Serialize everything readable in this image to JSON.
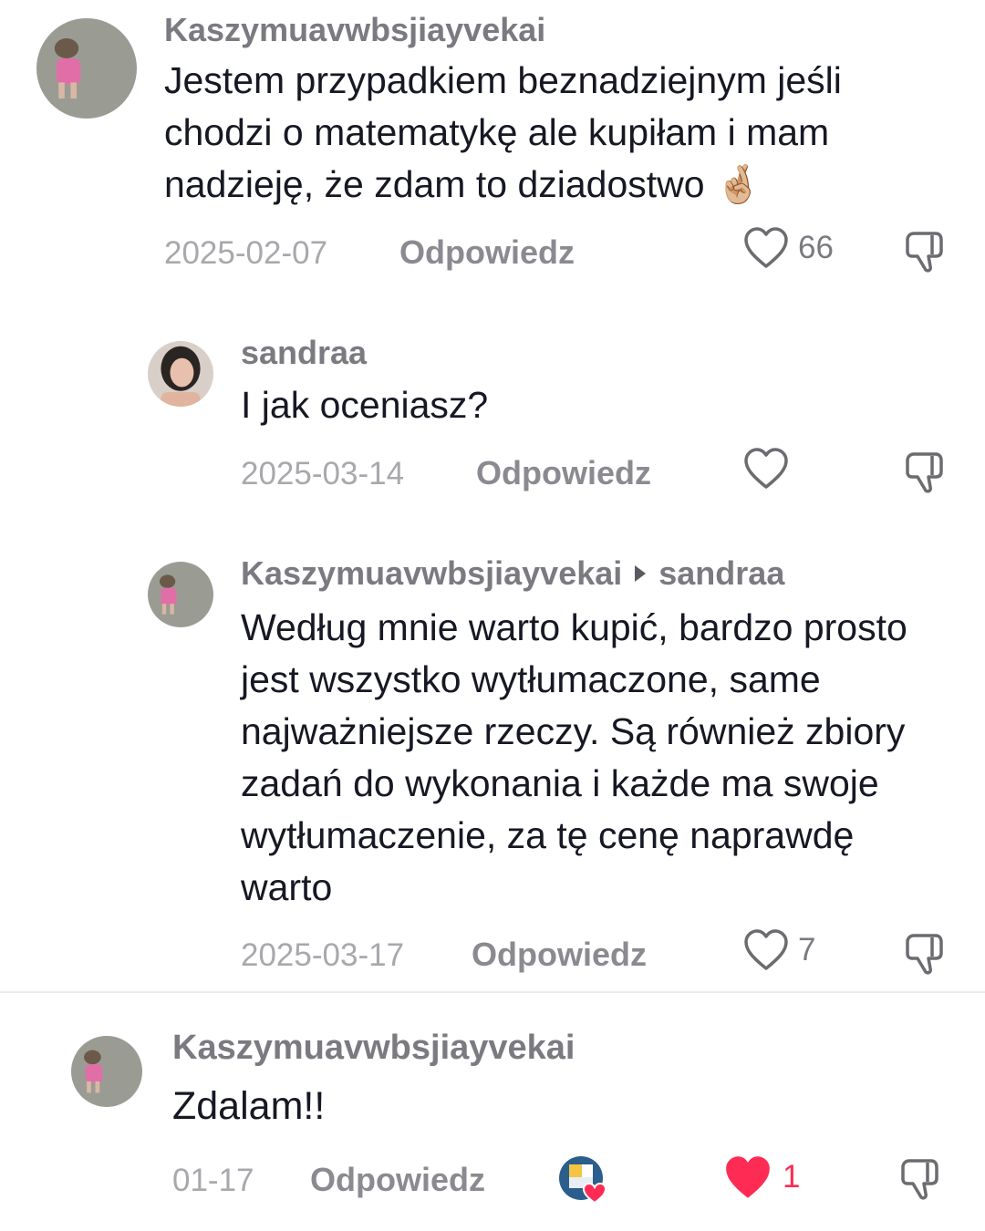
{
  "comments": [
    {
      "username": "Kaszymuavwbsjiayvekai",
      "text": "Jestem przypadkiem beznadziejnym jeśli chodzi o matematykę ale kupiłam i mam nadzieję, że zdam to dziadostwo 🤞🏼",
      "date": "2025-02-07",
      "reply_label": "Odpowiedz",
      "likes": "66",
      "avatar_icon": "pink-doll-avatar"
    },
    {
      "username": "sandraa",
      "text": "I jak oceniasz?",
      "date": "2025-03-14",
      "reply_label": "Odpowiedz",
      "likes": "",
      "avatar_icon": "person-photo-avatar"
    },
    {
      "username": "Kaszymuavwbsjiayvekai",
      "reply_to": "sandraa",
      "text": "Według mnie warto kupić, bardzo prosto jest wszystko wytłumaczone, same najważniejsze rzeczy. Są również zbiory zadań do wykonania i każde ma swoje wytłumaczenie, za tę cenę naprawdę warto",
      "date": "2025-03-17",
      "reply_label": "Odpowiedz",
      "likes": "7",
      "avatar_icon": "pink-doll-avatar"
    },
    {
      "username": "Kaszymuavwbsjiayvekai",
      "text": "Zdalam!!",
      "date": "01-17",
      "reply_label": "Odpowiedz",
      "likes": "1",
      "liked": true,
      "creator_liked_icon": "creator-heart-badge-icon",
      "avatar_icon": "pink-doll-avatar"
    }
  ],
  "colors": {
    "liked_heart": "#fe2c55",
    "username": "#7a7a80",
    "date": "#a8a8ad",
    "text": "#161823"
  }
}
